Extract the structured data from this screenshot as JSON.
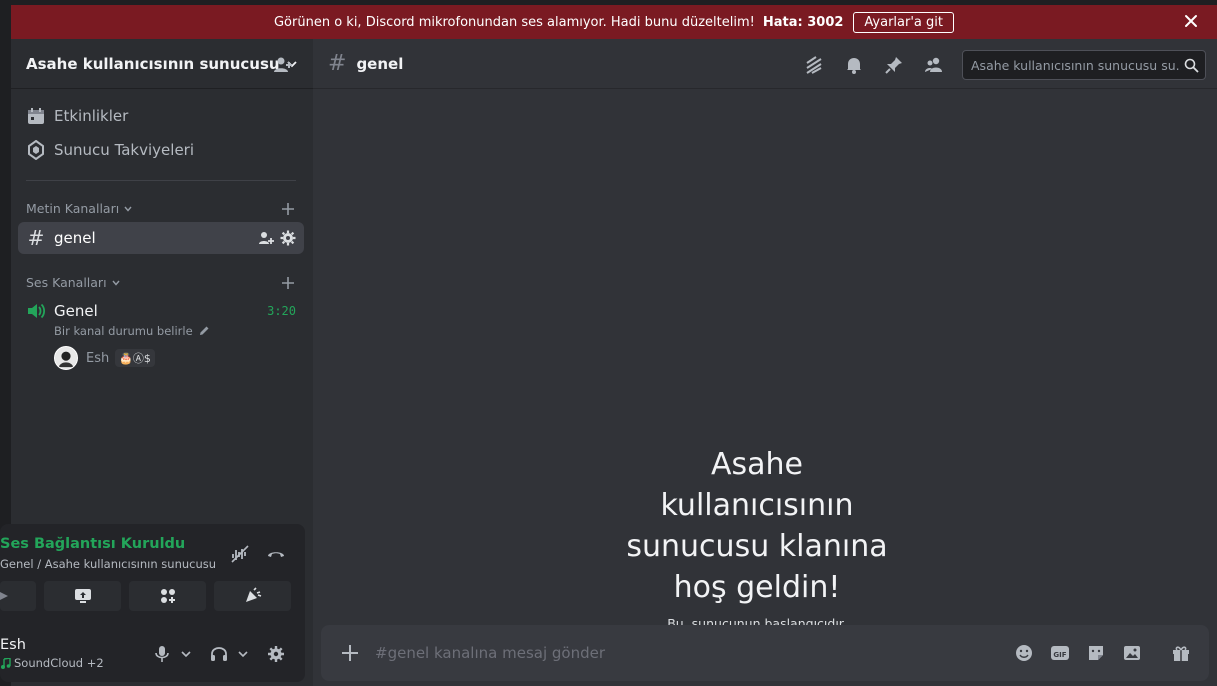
{
  "banner": {
    "message": "Görünen o ki, Discord mikrofonundan ses alamıyor. Hadi bunu düzeltelim!",
    "error_code": "Hata: 3002",
    "button_label": "Ayarlar'a git"
  },
  "server": {
    "name": "Asahe kullanıcısının sunucusu"
  },
  "sidebar": {
    "events_label": "Etkinlikler",
    "boosts_label": "Sunucu Takviyeleri",
    "text_category": "Metin Kanalları",
    "text_channel": "genel",
    "voice_category": "Ses Kanalları",
    "voice_channel": {
      "name": "Genel",
      "time": "3:20",
      "status": "Bir kanal durumu belirle",
      "user": "Esh",
      "badges": "🎂Ⓐ$"
    }
  },
  "voice_panel": {
    "title": "Ses Bağlantısı Kuruldu",
    "subtitle": "Genel / Asahe kullanıcısının sunucusu"
  },
  "user_panel": {
    "name": "Esh",
    "activity": "SoundCloud +2"
  },
  "main": {
    "channel_name": "genel",
    "search_placeholder": "Asahe kullanıcısının sunucusu su...",
    "welcome_title": "Asahe kullanıcısının sunucusu klanına hoş geldin!",
    "welcome_subtitle": "Bu, sunucunun başlangıcıdır.",
    "composer_placeholder": "#genel kanalına mesaj gönder"
  },
  "colors": {
    "banner_red": "#7a1a22",
    "voice_green": "#23a55a",
    "sidebar_bg": "#2b2d31",
    "main_bg": "#313338"
  }
}
